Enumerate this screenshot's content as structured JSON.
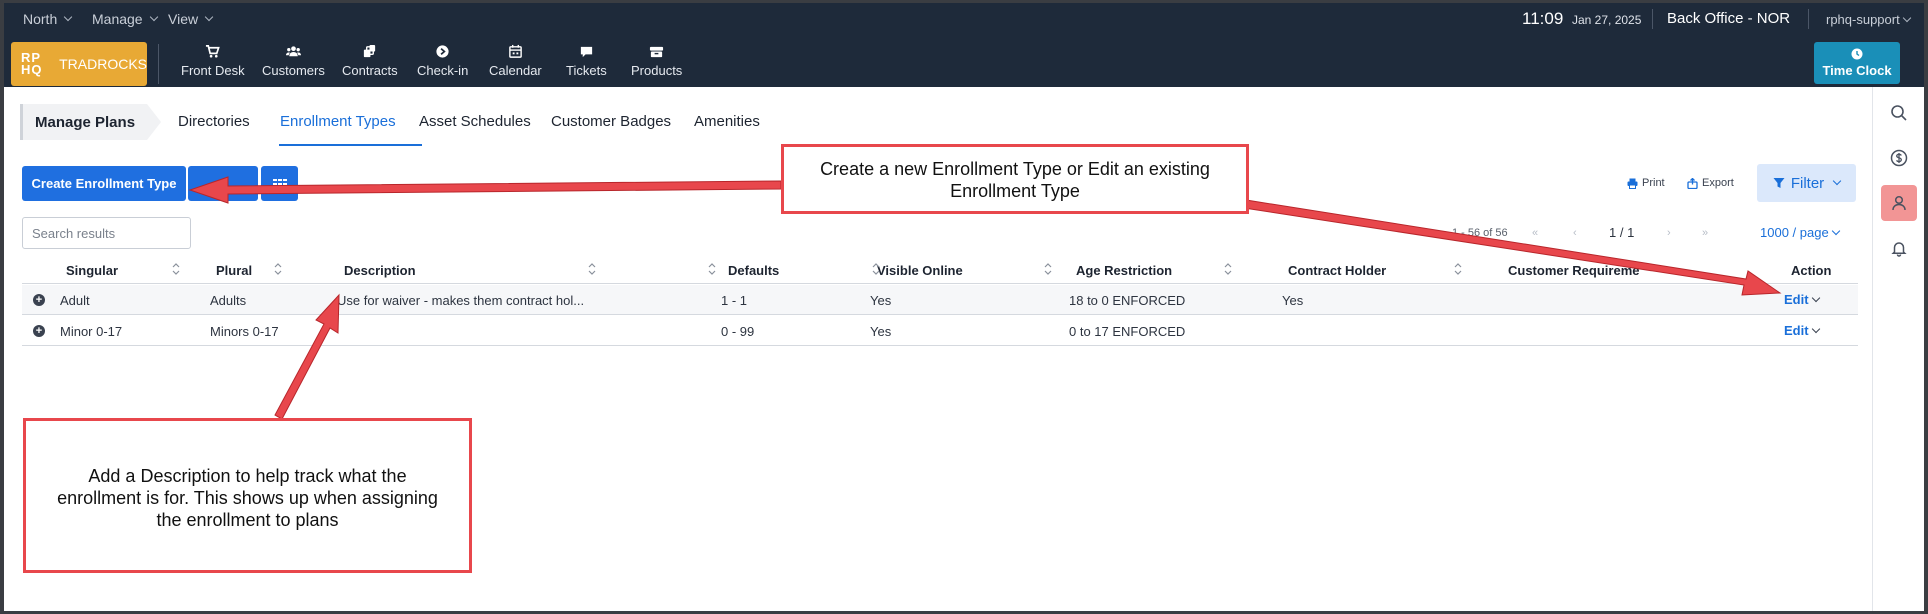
{
  "topbar": {
    "menus": [
      {
        "label": "North"
      },
      {
        "label": "Manage"
      },
      {
        "label": "View"
      }
    ],
    "time": "11:09",
    "date": "Jan 27, 2025",
    "office": "Back Office - NOR",
    "user": "rphq-support"
  },
  "navbar": {
    "logo_mark_line1": "RP",
    "logo_mark_line2": "HQ",
    "logo_brand": "TRADROCKS",
    "items": [
      {
        "label": "Front Desk",
        "icon": "cart-icon"
      },
      {
        "label": "Customers",
        "icon": "users-icon"
      },
      {
        "label": "Contracts",
        "icon": "contracts-icon"
      },
      {
        "label": "Check-in",
        "icon": "checkin-icon"
      },
      {
        "label": "Calendar",
        "icon": "calendar-icon"
      },
      {
        "label": "Tickets",
        "icon": "chat-icon"
      },
      {
        "label": "Products",
        "icon": "products-icon"
      }
    ],
    "time_clock_label": "Time Clock"
  },
  "tabs": {
    "root": "Manage Plans",
    "items": [
      {
        "label": "Directories"
      },
      {
        "label": "Enrollment Types",
        "active": true
      },
      {
        "label": "Asset Schedules"
      },
      {
        "label": "Customer Badges"
      },
      {
        "label": "Amenities"
      }
    ]
  },
  "toolbar": {
    "create_label": "Create Enrollment Type",
    "print_label": "Print",
    "export_label": "Export",
    "filter_label": "Filter"
  },
  "search": {
    "placeholder": "Search results"
  },
  "pagination": {
    "range": "1 - 56 of 56",
    "page": "1 / 1",
    "per_page": "1000 / page"
  },
  "table": {
    "columns": [
      "Singular",
      "Plural",
      "Description",
      "Defaults",
      "Visible Online",
      "Age Restriction",
      "Contract Holder",
      "Customer Requireme",
      "Action"
    ],
    "rows": [
      {
        "singular": "Adult",
        "plural": "Adults",
        "description": "Use for waiver - makes them contract hol...",
        "defaults": "1 - 1",
        "visible_online": "Yes",
        "age_restriction": "18 to 0 ENFORCED",
        "contract_holder": "Yes",
        "customer_requirements": "",
        "action": "Edit"
      },
      {
        "singular": "Minor 0-17",
        "plural": "Minors 0-17",
        "description": "",
        "defaults": "0 - 99",
        "visible_online": "Yes",
        "age_restriction": "0 to 17 ENFORCED",
        "contract_holder": "",
        "customer_requirements": "",
        "action": "Edit"
      }
    ]
  },
  "callouts": {
    "top_line1": "Create a new Enrollment Type or Edit an existing",
    "top_line2": "Enrollment Type",
    "bottom": "Add a Description to help track what the enrollment is for. This shows up when assigning the enrollment to plans"
  },
  "colors": {
    "nav_bg": "#1e2a3a",
    "accent": "#1f6fe0",
    "logo": "#e8a935",
    "time_clock": "#1a8fb8",
    "callout_border": "#e8474c"
  }
}
